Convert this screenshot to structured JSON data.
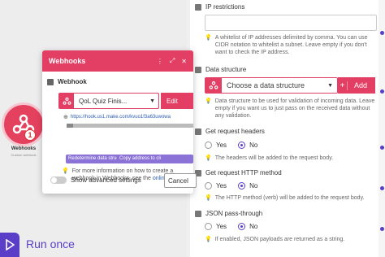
{
  "canvas": {
    "module": {
      "title": "Webhooks",
      "subtitle": "Custom webhook",
      "badge": "1"
    },
    "run_once": {
      "label": "Run once"
    }
  },
  "dialog": {
    "title": "Webhooks",
    "header_icons": [
      "more-icon",
      "maximize-icon",
      "close-icon"
    ],
    "section": "Webhook",
    "webhook_select": {
      "value": "QoL Quiz Finis...",
      "edit_label": "Edit"
    },
    "url": "https://hook.us1.make.com/kvuo1f3a63uwowa",
    "buttons": {
      "redetermine": "Redetermine data structure",
      "copy": "Copy address to cli"
    },
    "help": {
      "text": "For more information on how to create a webhook in Webhooks, see the",
      "link": "online Help",
      "tail": "."
    },
    "advanced_label": "Show advanced settings",
    "cancel_label": "Cancel"
  },
  "panel": {
    "ip": {
      "label": "IP restrictions",
      "value": "",
      "hint": "A whitelist of IP addresses delimited by comma. You can use CIDR notation to whitelist a subnet. Leave empty if you don't want to check the IP address."
    },
    "ds": {
      "label": "Data structure",
      "placeholder": "Choose a data structure",
      "add_label": "Add",
      "hint": "Data structure to be used for validation of incoming data. Leave empty if you want us to just pass on the received data without any validation."
    },
    "headers": {
      "label": "Get request headers",
      "yes": "Yes",
      "no": "No",
      "selected": "No",
      "hint": "The headers will be added to the request body."
    },
    "method": {
      "label": "Get request HTTP method",
      "yes": "Yes",
      "no": "No",
      "selected": "No",
      "hint": "The HTTP method (verb) will be added to the request body."
    },
    "json": {
      "label": "JSON pass-through",
      "yes": "Yes",
      "no": "No",
      "selected": "No",
      "hint": "If enabled, JSON payloads are returned as a string."
    }
  },
  "colors": {
    "brand": "#e33e63",
    "accent": "#5a3ec8",
    "chip": "#8b72d6"
  }
}
